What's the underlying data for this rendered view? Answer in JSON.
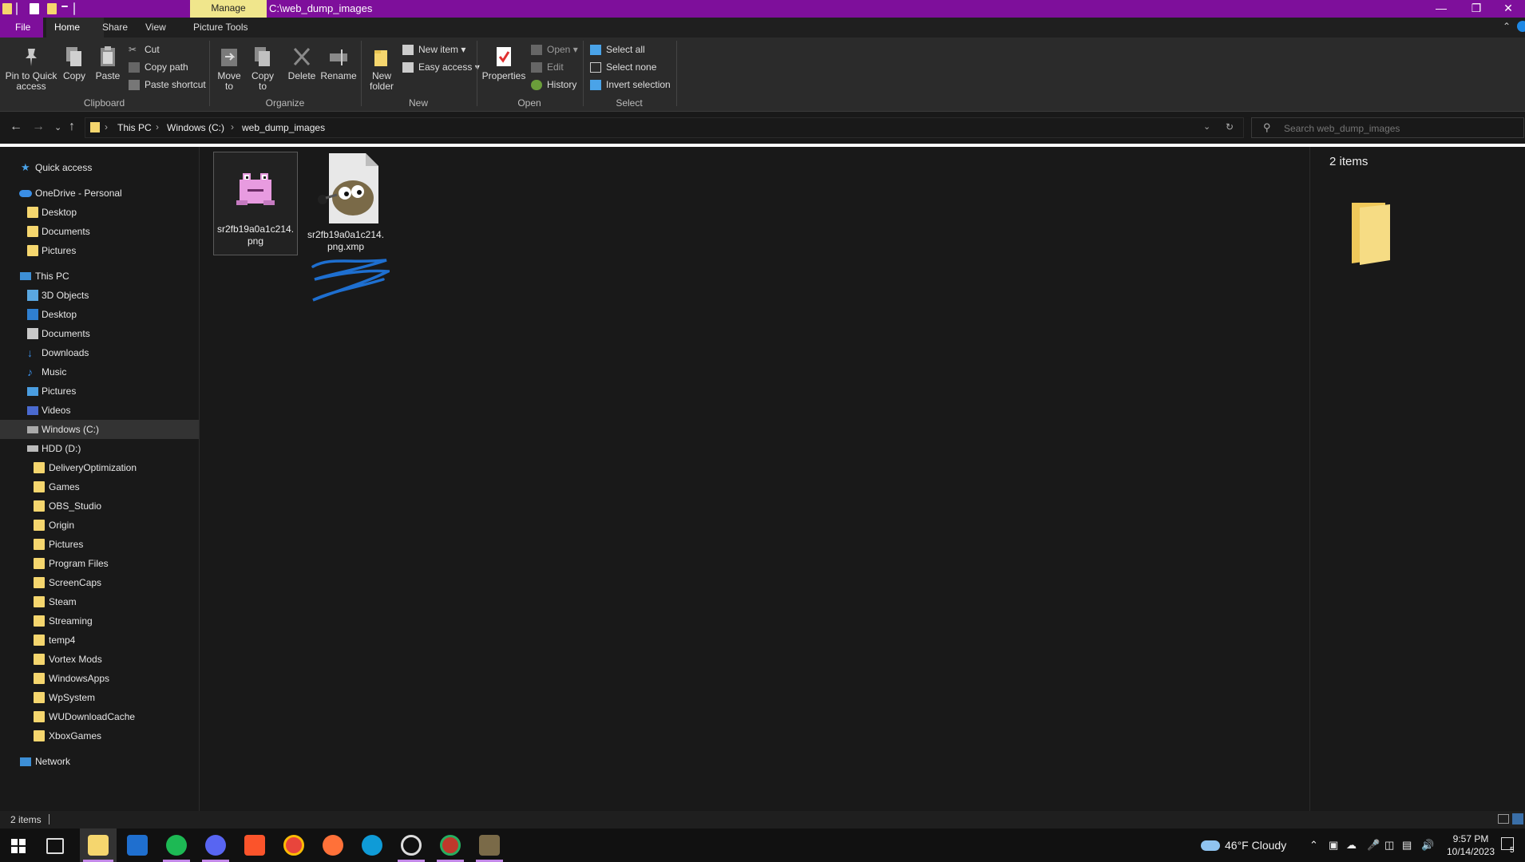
{
  "window": {
    "context_tab": "Manage",
    "title_path": "C:\\web_dump_images"
  },
  "menu_tabs": [
    "File",
    "Home",
    "Share",
    "View",
    "Picture Tools"
  ],
  "ribbon": {
    "clipboard": {
      "pin": "Pin to Quick access",
      "copy": "Copy",
      "paste": "Paste",
      "cut": "Cut",
      "copy_path": "Copy path",
      "paste_shortcut": "Paste shortcut",
      "group": "Clipboard"
    },
    "organize": {
      "move_to": "Move to",
      "copy_to": "Copy to",
      "delete": "Delete",
      "rename": "Rename",
      "group": "Organize"
    },
    "new": {
      "new_folder": "New folder",
      "new_item": "New item",
      "easy_access": "Easy access",
      "group": "New"
    },
    "open": {
      "properties": "Properties",
      "open": "Open",
      "edit": "Edit",
      "history": "History",
      "group": "Open"
    },
    "select": {
      "select_all": "Select all",
      "select_none": "Select none",
      "invert": "Invert selection",
      "group": "Select"
    }
  },
  "address": {
    "crumbs": [
      "This PC",
      "Windows (C:)",
      "web_dump_images"
    ],
    "search_placeholder": "Search web_dump_images"
  },
  "nav": {
    "quick_access": "Quick access",
    "onedrive": "OneDrive - Personal",
    "onedrive_items": [
      "Desktop",
      "Documents",
      "Pictures"
    ],
    "this_pc": "This PC",
    "pc_items": [
      "3D Objects",
      "Desktop",
      "Documents",
      "Downloads",
      "Music",
      "Pictures",
      "Videos",
      "Windows (C:)",
      "HDD (D:)"
    ],
    "hdd_items": [
      "DeliveryOptimization",
      "Games",
      "OBS_Studio",
      "Origin",
      "Pictures",
      "Program Files",
      "ScreenCaps",
      "Steam",
      "Streaming",
      "temp4",
      "Vortex Mods",
      "WindowsApps",
      "WpSystem",
      "WUDownloadCache",
      "XboxGames"
    ],
    "network": "Network"
  },
  "files": [
    {
      "name_line1": "sr2fb19a0a1c214.",
      "name_line2": "png",
      "icon": "frog-image-icon"
    },
    {
      "name_line1": "sr2fb19a0a1c214.",
      "name_line2": "png.xmp",
      "icon": "gimp-icon"
    }
  ],
  "preview": {
    "count": "2 items"
  },
  "status": {
    "count": "2 items"
  },
  "taskbar": {
    "weather": "46°F  Cloudy",
    "time": "9:57 PM",
    "date": "10/14/2023",
    "notifications": "5"
  }
}
